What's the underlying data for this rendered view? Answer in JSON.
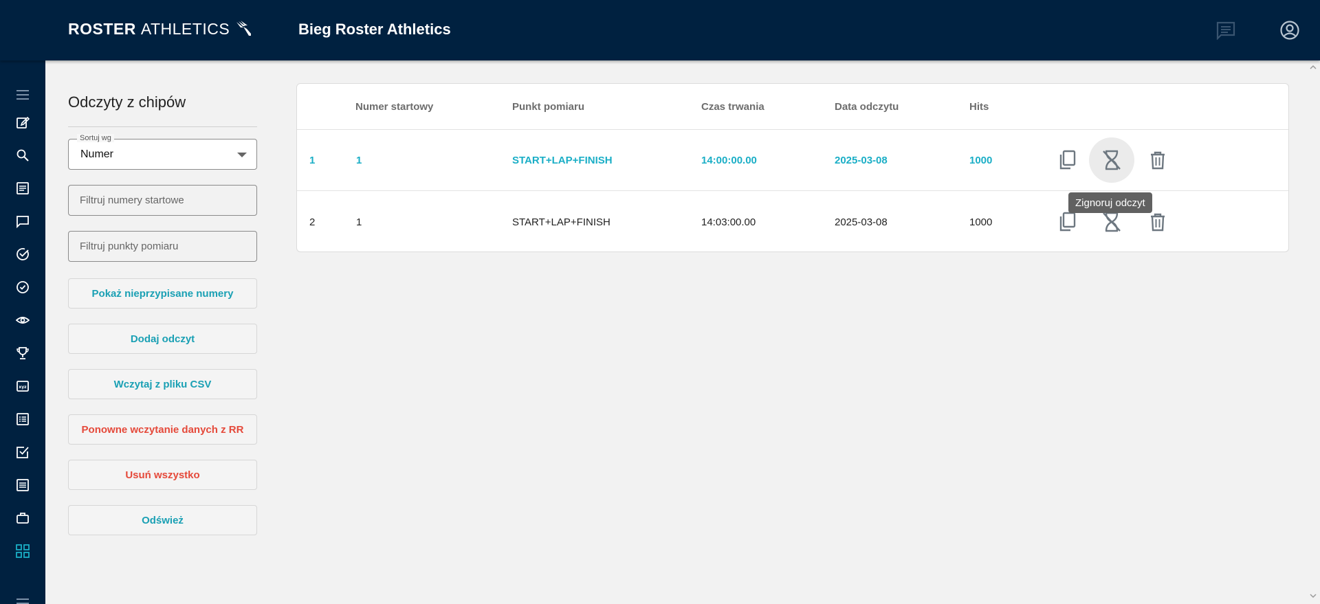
{
  "header": {
    "logo_bold": "ROSTER",
    "logo_light": "ATHLETICS",
    "event_title": "Bieg Roster Athletics",
    "icons": [
      "chat-icon",
      "account-icon"
    ]
  },
  "sidebar": {
    "icons": [
      "menu-icon",
      "edit-icon",
      "search-icon",
      "list-icon",
      "chat-icon",
      "check-circle-icon",
      "check-outline-icon",
      "eye-icon",
      "trophy-icon",
      "xyz-icon",
      "numbered-list-icon",
      "checkbox-icon",
      "document-icon",
      "briefcase-icon",
      "grid-icon",
      "menu-bottom-icon"
    ],
    "active": "grid-icon"
  },
  "left_panel": {
    "title": "Odczyty z chipów",
    "sort": {
      "label": "Sortuj wg",
      "value": "Numer"
    },
    "filter_numbers_placeholder": "Filtruj numery startowe",
    "filter_points_placeholder": "Filtruj punkty pomiaru",
    "buttons": {
      "show_unassigned": "Pokaż nieprzypisane numery",
      "add_read": "Dodaj odczyt",
      "load_csv": "Wczytaj z pliku CSV",
      "reload_rr": "Ponowne wczytanie danych z RR",
      "delete_all": "Usuń wszystko",
      "refresh": "Odśwież"
    }
  },
  "table": {
    "columns": [
      "",
      "Numer startowy",
      "Punkt pomiaru",
      "Czas trwania",
      "Data odczytu",
      "Hits"
    ],
    "rows": [
      {
        "index": "1",
        "bib": "1",
        "point": "START+LAP+FINISH",
        "duration": "14:00:00.00",
        "date": "2025-03-08",
        "hits": "1000"
      },
      {
        "index": "2",
        "bib": "1",
        "point": "START+LAP+FINISH",
        "duration": "14:03:00.00",
        "date": "2025-03-08",
        "hits": "1000"
      }
    ],
    "row_actions": [
      "copy-icon",
      "ignore-icon",
      "delete-icon"
    ]
  },
  "tooltip": {
    "text": "Zignoruj odczyt"
  },
  "colors": {
    "nav_bg": "#002140",
    "accent": "#1aaec6",
    "danger": "#e5493a"
  }
}
